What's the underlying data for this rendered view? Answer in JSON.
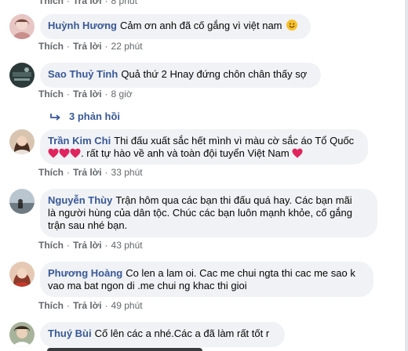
{
  "top_partial": {
    "like": "Thích",
    "reply": "Trả lời",
    "time": "8 phút"
  },
  "comments": [
    {
      "name": "Huỳnh Hương",
      "text": "Cảm ơn anh đã cố gắng vì việt nam",
      "text2": "",
      "like": "Thích",
      "reply": "Trả lời",
      "time": "22 phút"
    },
    {
      "name": "Sao Thuỷ Tinh",
      "text": "Quả thứ 2 Hnay đứng chôn chân thấy sợ",
      "text2": "",
      "like": "Thích",
      "reply": "Trả lời",
      "time": "8 giờ"
    },
    {
      "name": "Trần Kim Chi",
      "text": "Thi đấu xuất sắc hết mình vì màu cờ sắc áo Tổ Quốc",
      "text2": ". rất tự hào về anh và toàn đội tuyển Việt Nam",
      "like": "Thích",
      "reply": "Trả lời",
      "time": "33 phút"
    },
    {
      "name": "Nguyễn Thùy",
      "text": "Trận hôm qua các bạn thi đấu quá hay. Các bạn mãi",
      "text2": "là người hùng của dân tộc. Chúc các bạn luôn mạnh khỏe, cố gắng",
      "text3": "trận sau nhé bạn.",
      "like": "Thích",
      "reply": "Trả lời",
      "time": "43 phút"
    },
    {
      "name": "Phương Hoàng",
      "text": "Co len a lam oi. Cac me chui ngta thi cac me sao k",
      "text2": "vao ma bat ngon di .me chui ng khac thi gioi",
      "like": "Thích",
      "reply": "Trả lời",
      "time": "49 phút"
    },
    {
      "name": "Thuý Bùi",
      "text": "Cố lên các a nhé.Các a đã làm rất tốt r",
      "text2": ""
    }
  ],
  "replies_link": "3 phản hồi",
  "emoji_names": [
    "smile-emoji",
    "red-heart-emoji"
  ],
  "colors": {
    "name": "#385898",
    "bubble": "#f0f2f5",
    "meta": "#65676b",
    "heart": "#e0245e"
  }
}
